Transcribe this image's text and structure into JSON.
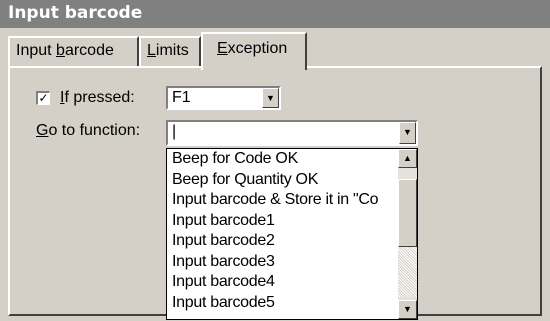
{
  "window": {
    "title": "Input barcode"
  },
  "tabs": [
    {
      "label": "Input barcode",
      "mnemonic_prefix": "Input ",
      "mnemonic": "b",
      "mnemonic_suffix": "arcode"
    },
    {
      "label": "Limits",
      "mnemonic_prefix": "",
      "mnemonic": "L",
      "mnemonic_suffix": "imits"
    },
    {
      "label": "Exception",
      "mnemonic_prefix": "",
      "mnemonic": "E",
      "mnemonic_suffix": "xception",
      "active": true
    }
  ],
  "exception": {
    "if_pressed": {
      "checked": true,
      "check_glyph": "✓",
      "label_mnemonic": "I",
      "label_rest": "f pressed:",
      "value": "F1"
    },
    "go_to_function": {
      "label_mnemonic": "G",
      "label_rest": "o to function:",
      "value": "|",
      "options": [
        "Beep for Code OK",
        "Beep for Quantity OK",
        "Input barcode & Store it in \"Co",
        "Input barcode1",
        "Input barcode2",
        "Input barcode3",
        "Input barcode4",
        "Input barcode5"
      ]
    }
  },
  "icons": {
    "dropdown_arrow": "▼",
    "scroll_up": "▲",
    "scroll_down": "▼"
  }
}
